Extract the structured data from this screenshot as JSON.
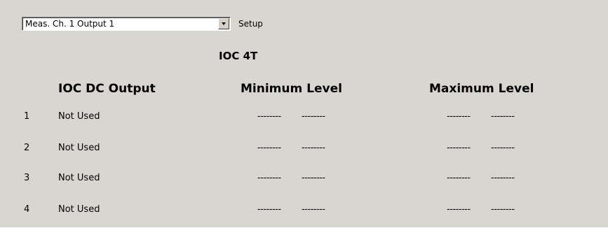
{
  "selector": {
    "value": "Meas. Ch. 1 Output 1"
  },
  "setup_label": "Setup",
  "title": "IOC 4T",
  "headers": {
    "output": "IOC DC Output",
    "minimum": "Minimum Level",
    "maximum": "Maximum Level"
  },
  "rows": [
    {
      "num": "1",
      "output": "Not Used",
      "min_a": "--------",
      "min_b": "--------",
      "max_a": "--------",
      "max_b": "--------"
    },
    {
      "num": "2",
      "output": "Not Used",
      "min_a": "--------",
      "min_b": "--------",
      "max_a": "--------",
      "max_b": "--------"
    },
    {
      "num": "3",
      "output": "Not Used",
      "min_a": "--------",
      "min_b": "--------",
      "max_a": "--------",
      "max_b": "--------"
    },
    {
      "num": "4",
      "output": "Not Used",
      "min_a": "--------",
      "min_b": "--------",
      "max_a": "--------",
      "max_b": "--------"
    }
  ],
  "colors": {
    "panel": "#d8d6d0",
    "text": "#000000"
  },
  "icons": {
    "dropdown": "chevron-down-icon"
  }
}
